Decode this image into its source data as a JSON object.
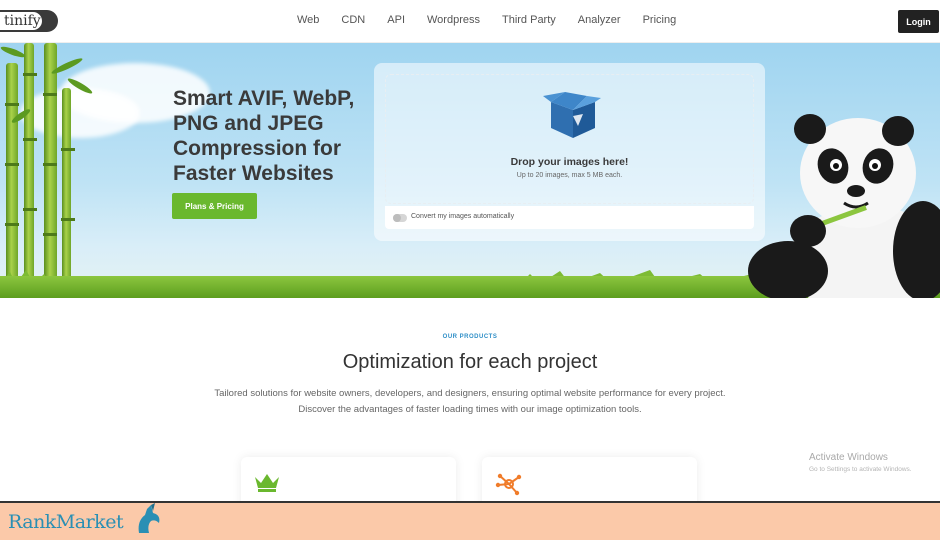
{
  "header": {
    "logo_text": "tinify",
    "nav": [
      "Web",
      "CDN",
      "API",
      "Wordpress",
      "Third Party",
      "Analyzer",
      "Pricing"
    ],
    "login_label": "Login"
  },
  "hero": {
    "title": "Smart AVIF, WebP, PNG and JPEG Compression for Faster Websites",
    "cta_label": "Plans & Pricing",
    "drop_title": "Drop your images here!",
    "drop_subtitle": "Up to 20 images, max 5 MB each.",
    "convert_label": "Convert my images automatically",
    "convert_enabled": false
  },
  "products": {
    "eyebrow": "OUR PRODUCTS",
    "title": "Optimization for each project",
    "description": "Tailored solutions for website owners, developers, and designers, ensuring optimal website performance for every project. Discover the advantages of faster loading times with our image optimization tools.",
    "cards": [
      {
        "icon": "crown-icon",
        "color": "#6ab82e"
      },
      {
        "icon": "network-icon",
        "color": "#f07c2a"
      }
    ]
  },
  "os_overlay": {
    "title": "Activate Windows",
    "subtitle": "Go to Settings to activate Windows."
  },
  "banner": {
    "brand": "RankMarket"
  },
  "colors": {
    "accent_green": "#6ab82e",
    "login_bg": "#222222",
    "eyebrow_blue": "#2f8fc7",
    "banner_bg": "#fbc9a9",
    "brand_blue": "#2a8fb4"
  }
}
